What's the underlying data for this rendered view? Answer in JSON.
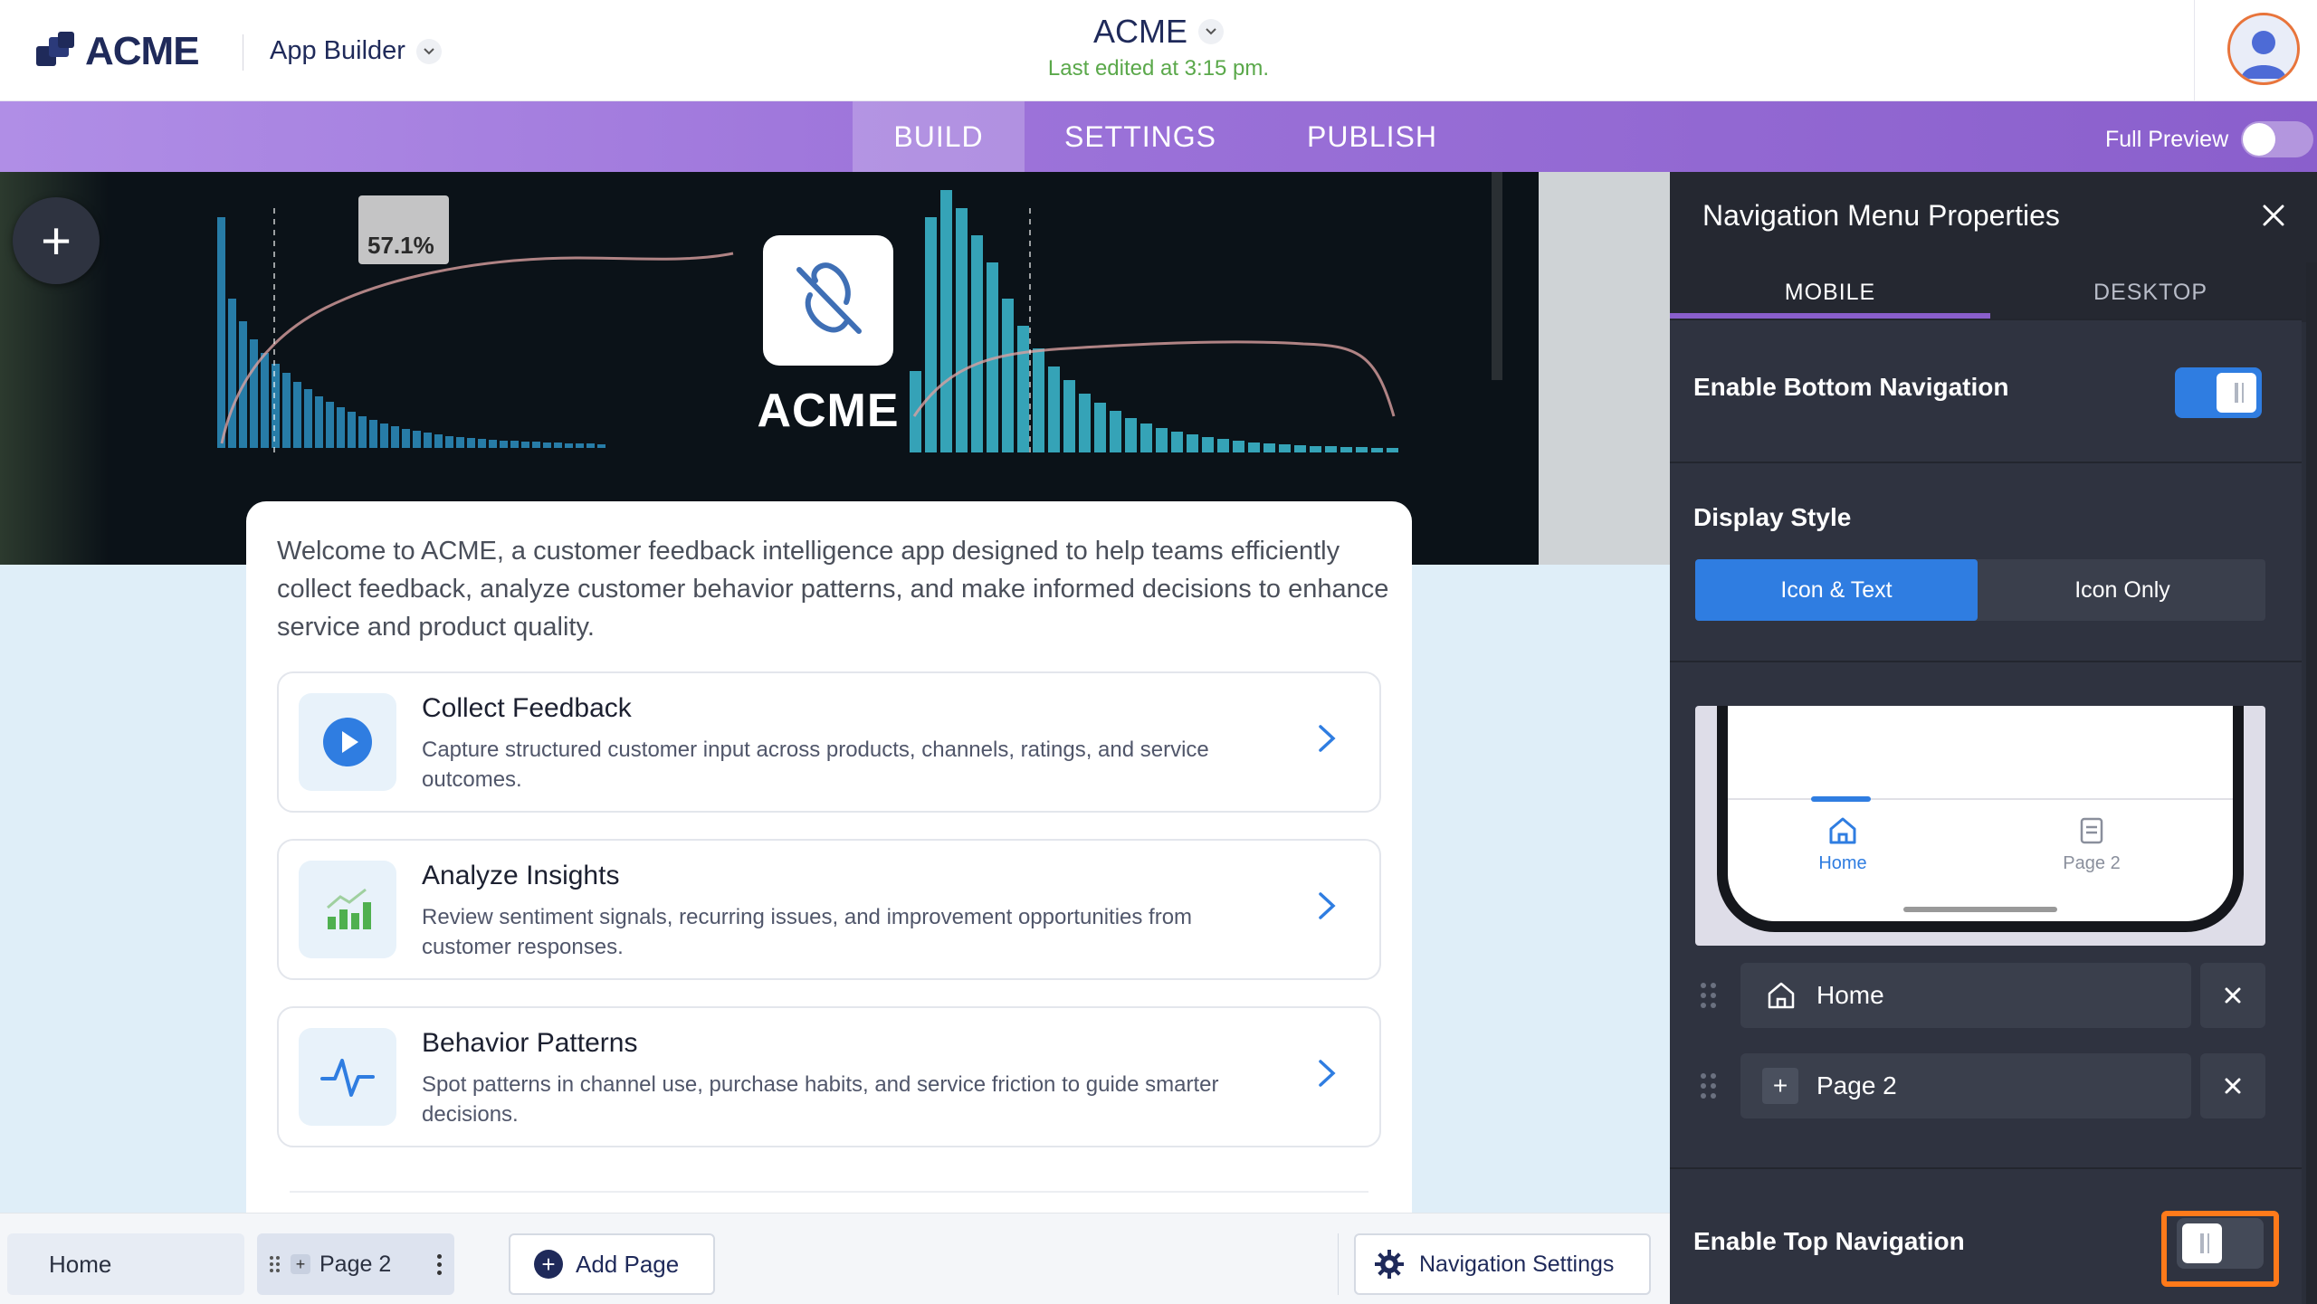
{
  "header": {
    "logo_text": "ACME",
    "app_builder_label": "App Builder",
    "project_name": "ACME",
    "last_edited": "Last edited at 3:15 pm."
  },
  "nav": {
    "tabs": [
      {
        "label": "BUILD",
        "active": true
      },
      {
        "label": "SETTINGS",
        "active": false
      },
      {
        "label": "PUBLISH",
        "active": false
      }
    ],
    "full_preview_label": "Full Preview",
    "full_preview_on": false
  },
  "hero": {
    "brand_name": "ACME",
    "overlay_value": "57.1%"
  },
  "content": {
    "welcome": "Welcome to ACME, a customer feedback intelligence app designed to help teams efficiently collect feedback, analyze customer behavior patterns, and make informed decisions to enhance service and product quality.",
    "features": [
      {
        "title": "Collect Feedback",
        "desc": "Capture structured customer input across products, channels, ratings, and service outcomes.",
        "icon": "play-circle-icon"
      },
      {
        "title": "Analyze Insights",
        "desc": "Review sentiment signals, recurring issues, and improvement opportunities from customer responses.",
        "icon": "bar-chart-icon"
      },
      {
        "title": "Behavior Patterns",
        "desc": "Spot patterns in channel use, purchase habits, and service friction to guide smarter decisions.",
        "icon": "pulse-icon"
      }
    ]
  },
  "pagebar": {
    "home_label": "Home",
    "page2_label": "Page 2",
    "add_page_label": "Add Page",
    "nav_settings_label": "Navigation Settings"
  },
  "panel": {
    "title": "Navigation Menu Properties",
    "tabs": [
      {
        "label": "MOBILE",
        "active": true
      },
      {
        "label": "DESKTOP",
        "active": false
      }
    ],
    "enable_bottom_label": "Enable Bottom Navigation",
    "enable_bottom_on": true,
    "display_style_label": "Display Style",
    "display_options": [
      {
        "label": "Icon & Text",
        "selected": true
      },
      {
        "label": "Icon Only",
        "selected": false
      }
    ],
    "preview_items": [
      {
        "label": "Home",
        "active": true
      },
      {
        "label": "Page 2",
        "active": false
      }
    ],
    "nav_items": [
      {
        "label": "Home",
        "icon": "home-icon"
      },
      {
        "label": "Page 2",
        "icon": "plus-icon"
      }
    ],
    "enable_top_label": "Enable Top Navigation",
    "enable_top_on": false
  },
  "colors": {
    "accent_purple": "#8a5fcc",
    "primary_blue": "#2f7de1",
    "highlight_orange": "#ff7a1a",
    "edited_green": "#5aa84a",
    "brand_navy": "#1f2a5a"
  }
}
